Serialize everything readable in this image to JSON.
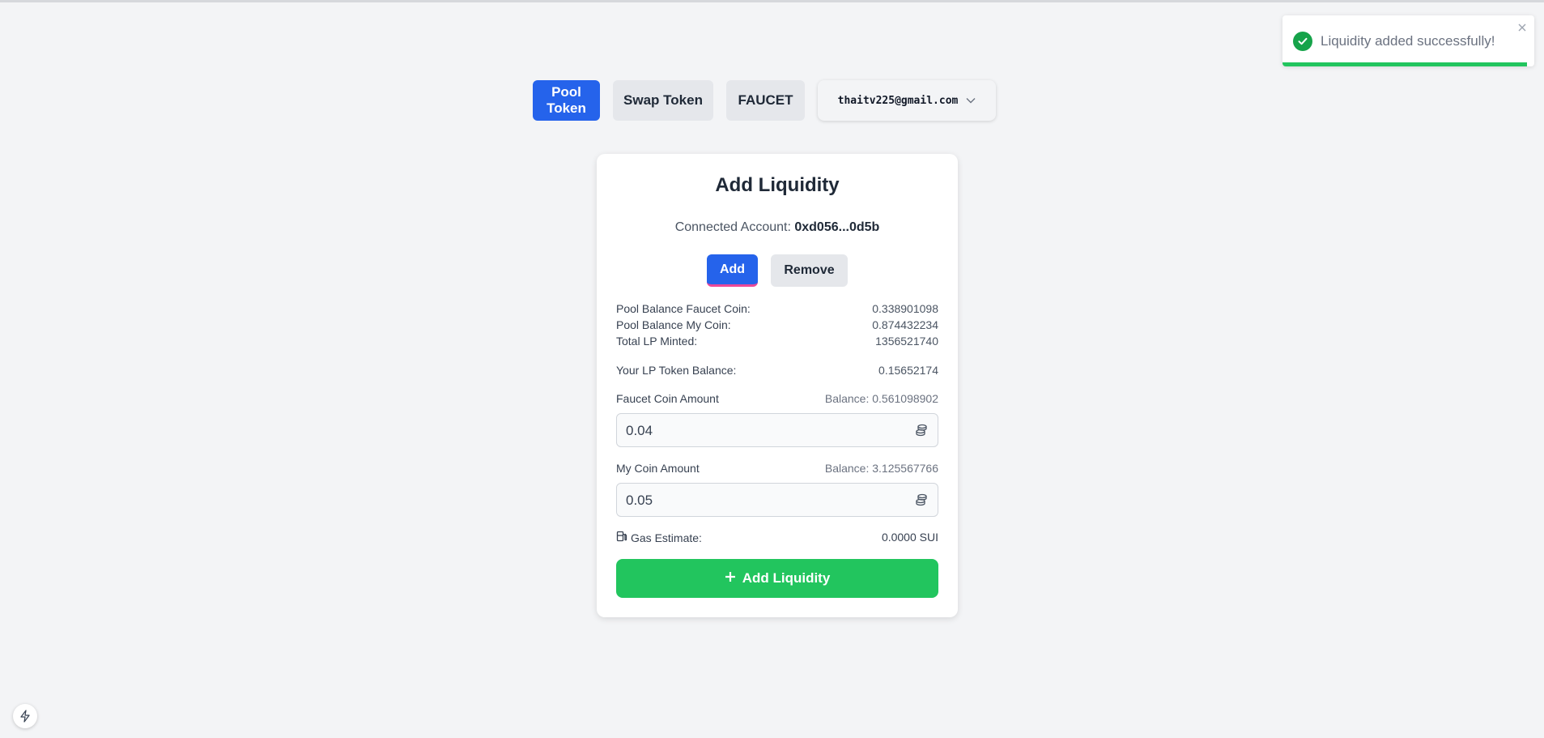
{
  "nav": {
    "pool_label": "Pool Token",
    "swap_label": "Swap Token",
    "faucet_label": "FAUCET",
    "account_email": "thaitv225@gmail.com"
  },
  "toast": {
    "message": "Liquidity added successfully!",
    "progress": 0.97
  },
  "card": {
    "title": "Add Liquidity",
    "connected_label": "Connected Account:",
    "connected_value": "0xd056...0d5b",
    "mode_add": "Add",
    "mode_remove": "Remove",
    "stats": [
      {
        "label": "Pool Balance Faucet Coin:",
        "value": "0.338901098"
      },
      {
        "label": "Pool Balance My Coin:",
        "value": "0.874432234"
      },
      {
        "label": "Total LP Minted:",
        "value": "1356521740"
      }
    ],
    "lp_balance_label": "Your LP Token Balance:",
    "lp_balance_value": "0.15652174",
    "faucet_field": {
      "label": "Faucet Coin Amount",
      "balance": "Balance: 0.561098902",
      "value": "0.04"
    },
    "mycoin_field": {
      "label": "My Coin Amount",
      "balance": "Balance: 3.125567766",
      "value": "0.05"
    },
    "gas_label": "Gas Estimate:",
    "gas_value": "0.0000 SUI",
    "submit_label": "Add Liquidity"
  },
  "colors": {
    "primary": "#2563eb",
    "success": "#22c55e",
    "background": "#f3f4f6"
  },
  "icons": [
    "check-circle-icon",
    "close-icon",
    "chevron-down-icon",
    "coins-icon",
    "gas-pump-icon",
    "plus-icon",
    "bolt-icon"
  ]
}
